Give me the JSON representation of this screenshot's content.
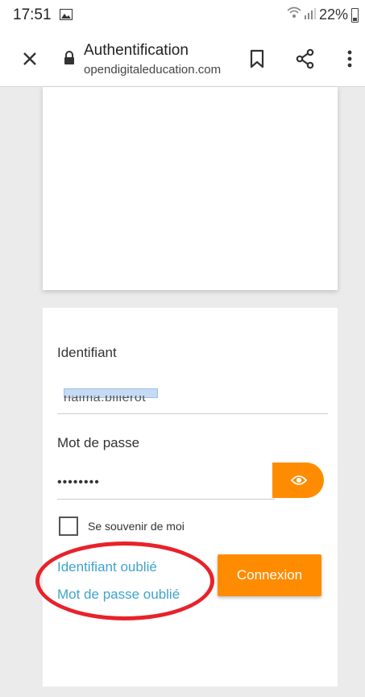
{
  "status_bar": {
    "time": "17:51",
    "battery": "22%",
    "icons": [
      "image-icon",
      "wifi-icon",
      "signal-icon",
      "battery-icon"
    ]
  },
  "toolbar": {
    "title": "Authentification",
    "url": "opendigitaleducation.com",
    "icons": [
      "close-icon",
      "lock-icon",
      "bookmark-icon",
      "share-icon",
      "more-vert-icon"
    ]
  },
  "form": {
    "identifier_label": "Identifiant",
    "identifier_value": "naima.billerot",
    "password_label": "Mot de passe",
    "password_value": "••••••••",
    "remember_label": "Se souvenir de moi",
    "remember_checked": false,
    "forgot_id_link": "Identifiant oublié",
    "forgot_password_link": "Mot de passe oublié",
    "connect_button": "Connexion"
  },
  "colors": {
    "accent": "#ff8c00",
    "link": "#3fa3cc",
    "annotation": "#e8222a",
    "background": "#ebebeb"
  }
}
